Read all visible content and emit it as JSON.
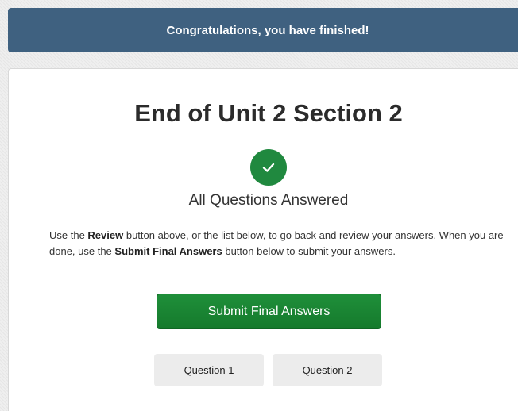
{
  "banner": {
    "text": "Congratulations, you have finished!"
  },
  "main": {
    "title": "End of Unit 2 Section 2",
    "status_icon": "check-icon",
    "status_text": "All Questions Answered",
    "instructions": {
      "part1": "Use the ",
      "review_label": "Review",
      "part2": " button above, or the list below, to go back and review your answers. When you are done, use the ",
      "submit_ref_label": "Submit Final Answers",
      "part3": " button below to submit your answers."
    },
    "submit_label": "Submit Final Answers",
    "questions": [
      {
        "label": "Question 1"
      },
      {
        "label": "Question 2"
      }
    ]
  },
  "colors": {
    "banner": "#3f6180",
    "success": "#20893f",
    "submit": "#1a8634",
    "question_button": "#ececec"
  }
}
